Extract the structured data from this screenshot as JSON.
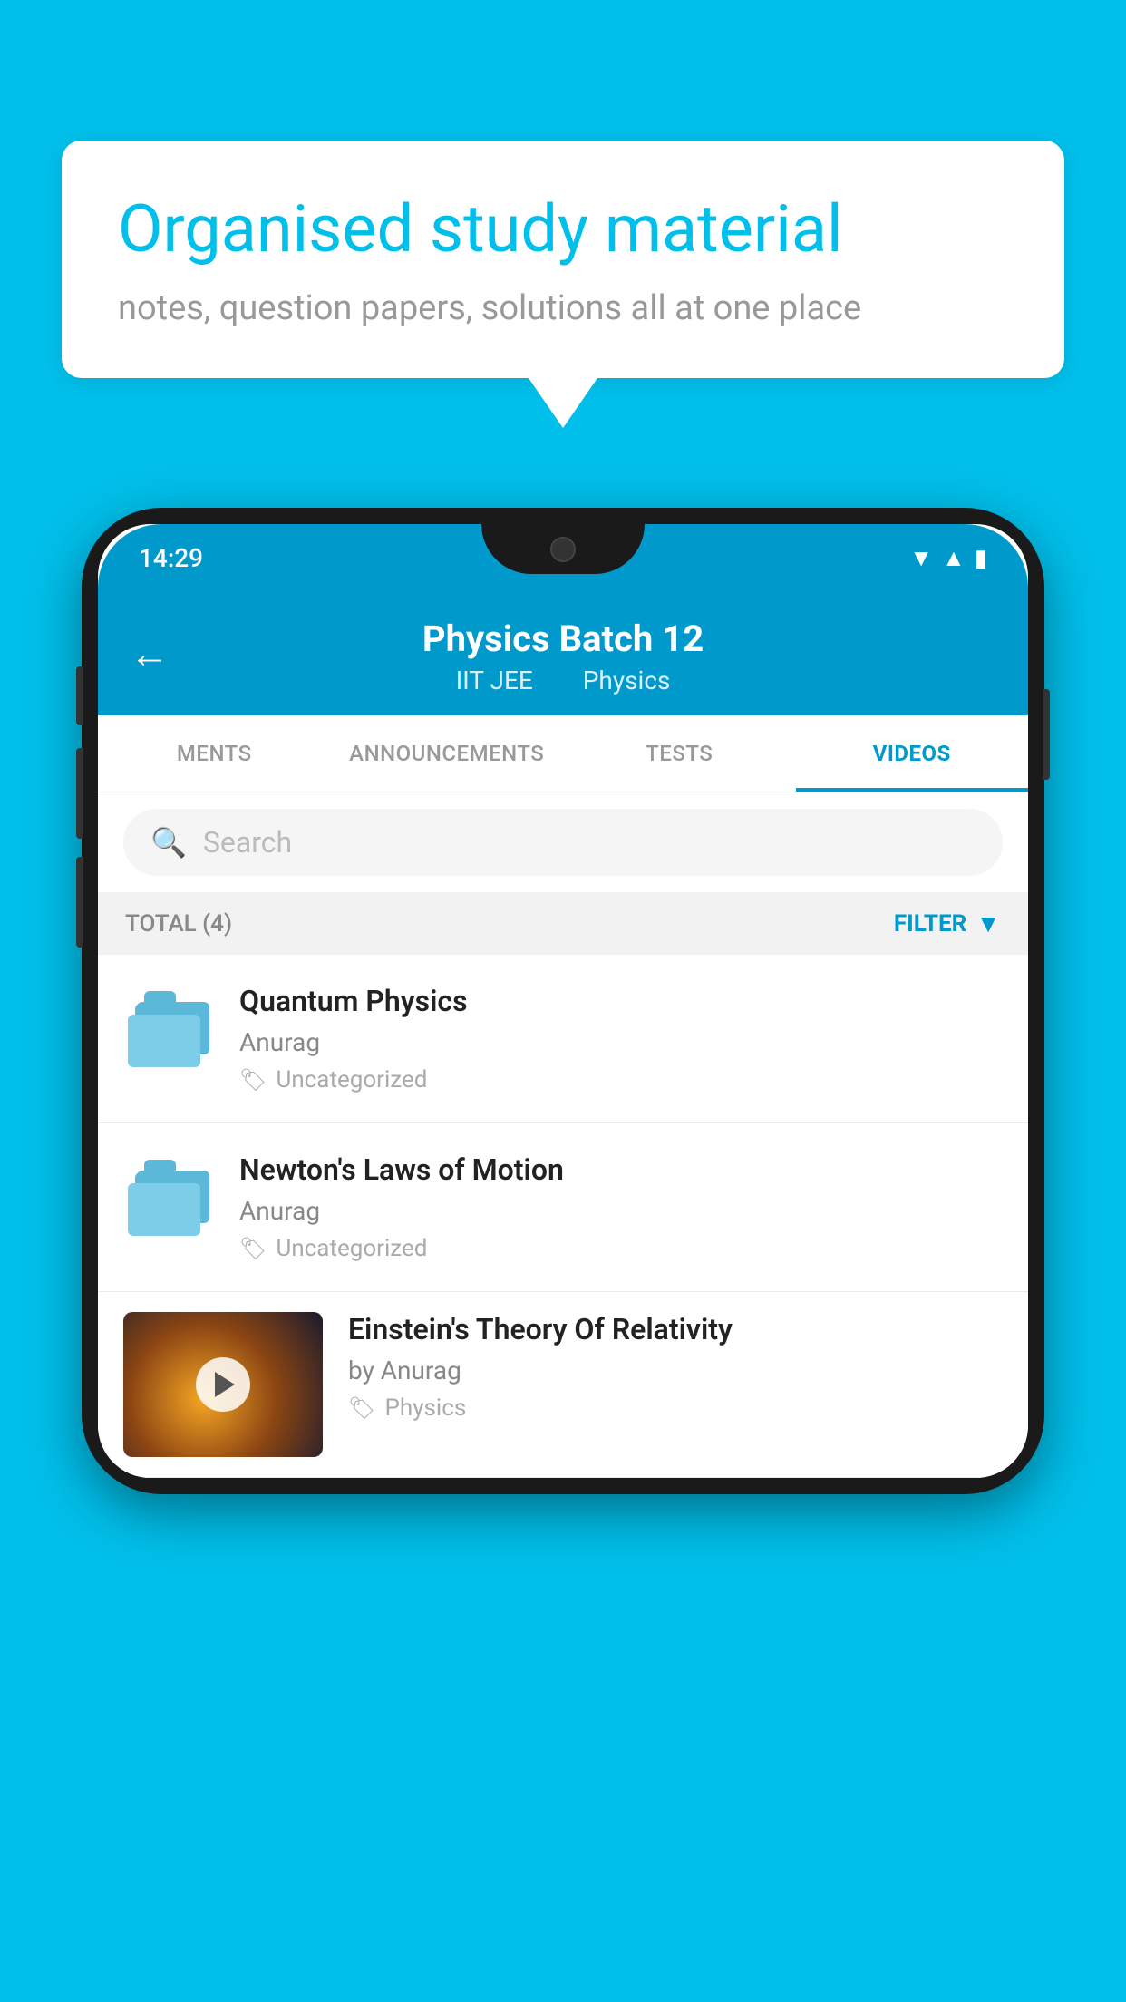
{
  "background": {
    "color": "#00BFEA"
  },
  "speech_bubble": {
    "title": "Organised study material",
    "subtitle": "notes, question papers, solutions all at one place"
  },
  "phone": {
    "status_bar": {
      "time": "14:29"
    },
    "header": {
      "title": "Physics Batch 12",
      "subtitle_part1": "IIT JEE",
      "subtitle_part2": "Physics",
      "back_label": "←"
    },
    "tabs": [
      {
        "label": "MENTS",
        "active": false
      },
      {
        "label": "ANNOUNCEMENTS",
        "active": false
      },
      {
        "label": "TESTS",
        "active": false
      },
      {
        "label": "VIDEOS",
        "active": true
      }
    ],
    "search": {
      "placeholder": "Search"
    },
    "filter": {
      "total_label": "TOTAL (4)",
      "button_label": "FILTER"
    },
    "videos": [
      {
        "title": "Quantum Physics",
        "author": "Anurag",
        "tag": "Uncategorized",
        "has_thumb": false
      },
      {
        "title": "Newton's Laws of Motion",
        "author": "Anurag",
        "tag": "Uncategorized",
        "has_thumb": false
      },
      {
        "title": "Einstein's Theory Of Relativity",
        "author": "by Anurag",
        "tag": "Physics",
        "has_thumb": true
      }
    ]
  }
}
